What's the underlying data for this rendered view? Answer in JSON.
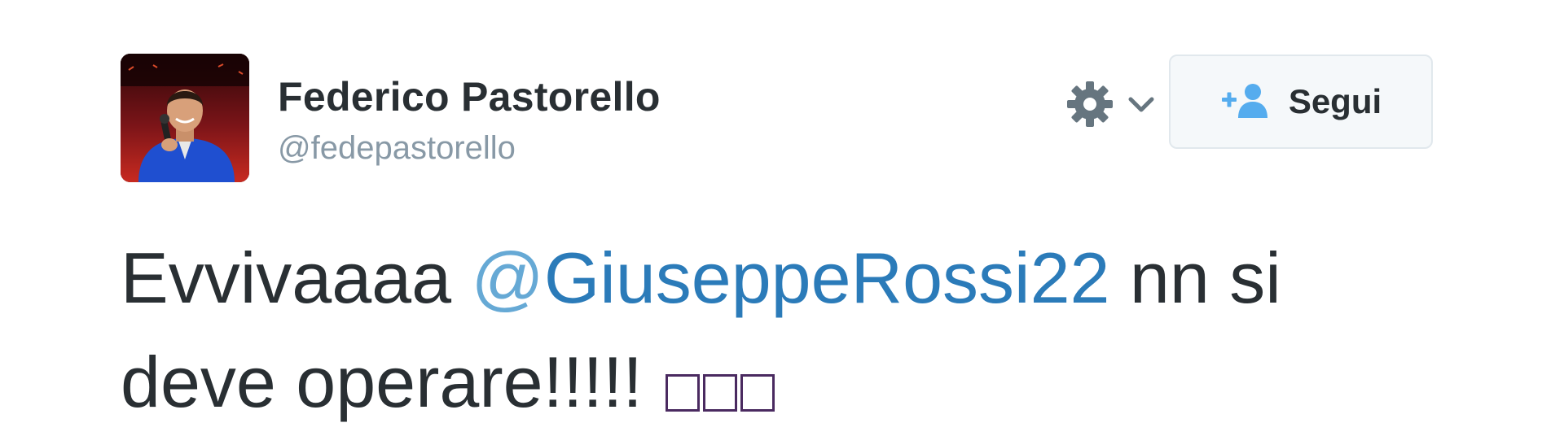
{
  "author": {
    "name": "Federico Pastorello",
    "handle": "@fedepastorello"
  },
  "actions": {
    "gear_icon": "gear-icon",
    "chevron_icon": "chevron-down-icon",
    "follow_icon": "add-user-icon",
    "follow_label": "Segui"
  },
  "tweet": {
    "text_before": "Evvivaaaa ",
    "mention_at": "@",
    "mention_user": "GiuseppeRossi22",
    "text_after": " nn si deve operare!!!!! "
  },
  "colors": {
    "text": "#292f33",
    "handle": "#8899a6",
    "mention": "#2b7bb9",
    "follow_icon": "#55acee",
    "gear": "#66757f"
  }
}
